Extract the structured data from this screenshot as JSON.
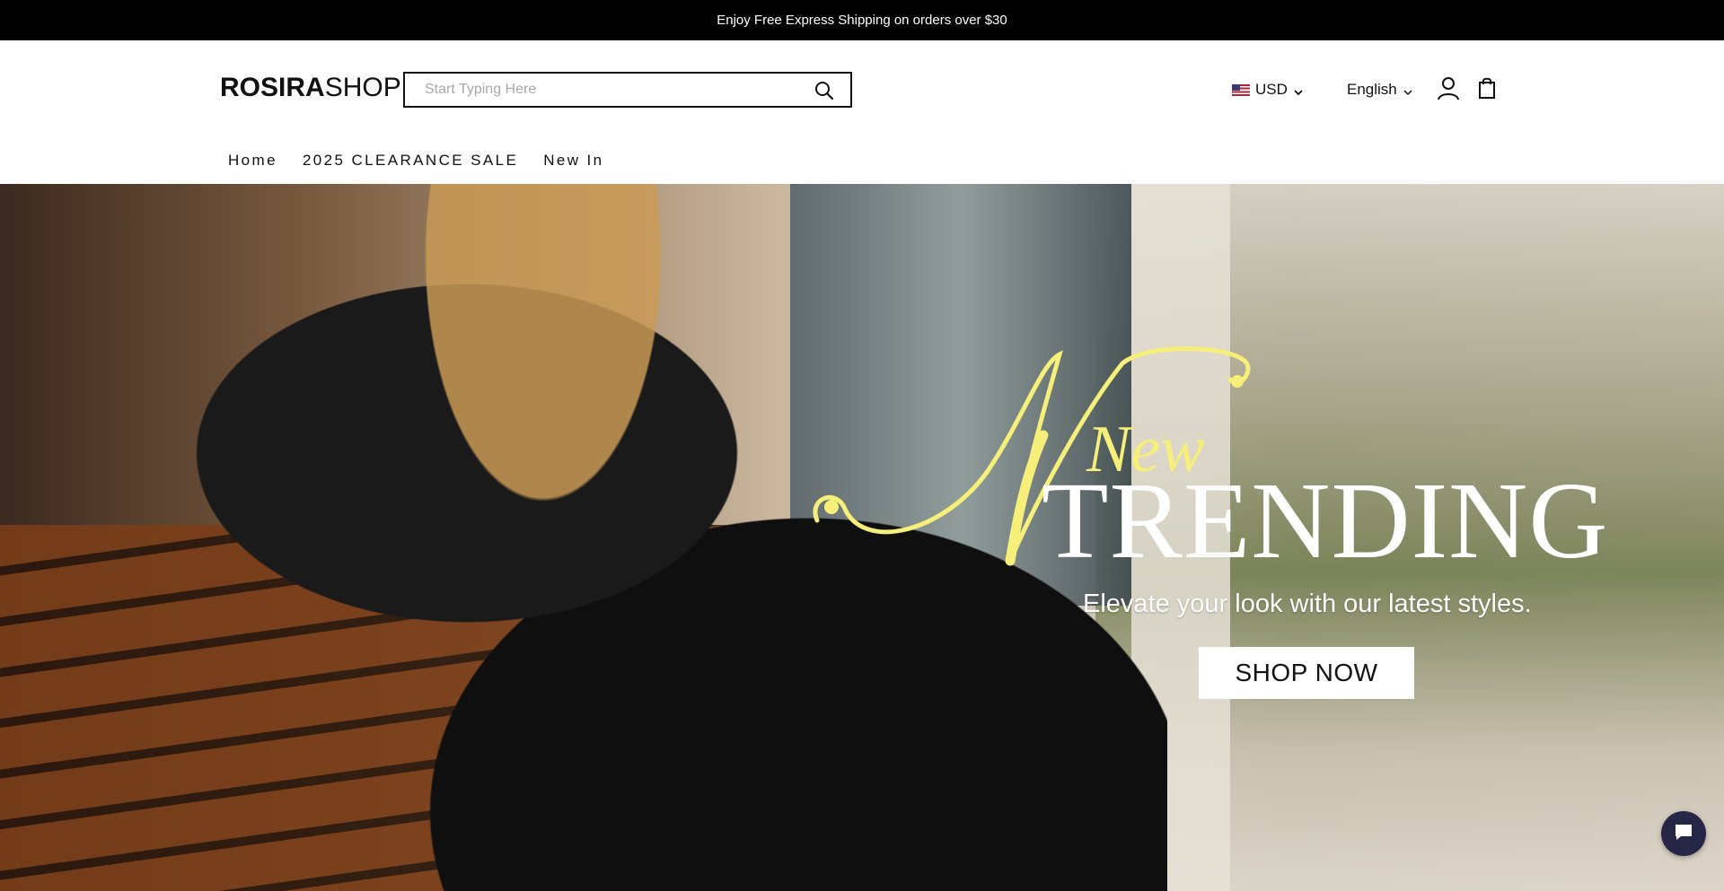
{
  "announcement": {
    "text": "Enjoy Free Express Shipping on orders over $30"
  },
  "header": {
    "logo_bold": "ROSIRA",
    "logo_light": "SHOP",
    "search_placeholder": "Start Typing Here",
    "currency": "USD",
    "language": "English"
  },
  "nav": {
    "items": [
      {
        "label": "Home"
      },
      {
        "label": "2025 CLEARANCE SALE"
      },
      {
        "label": "New In"
      }
    ]
  },
  "hero": {
    "script_word": "New",
    "headline": "TRENDING",
    "tagline": "Elevate your look with our latest styles.",
    "cta_label": "SHOP NOW",
    "script_color": "#f6f07a"
  },
  "icons": {
    "search": "search-icon",
    "account": "account-icon",
    "cart": "shopping-bag-icon",
    "chat": "chat-icon"
  }
}
